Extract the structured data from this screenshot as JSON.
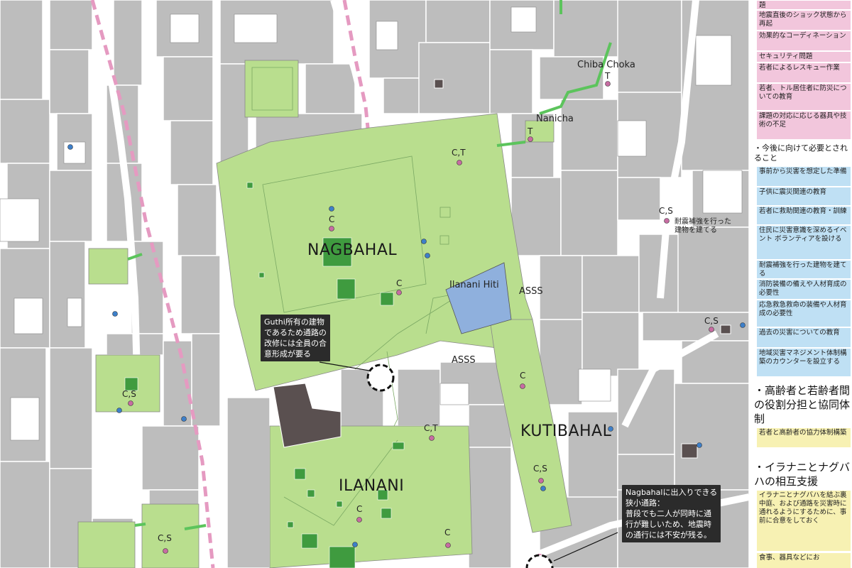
{
  "map": {
    "areas": [
      "NAGBAHAL",
      "ILANANI",
      "KUTIBAHAL"
    ],
    "places": [
      "Chiba Choka",
      "Nanicha",
      "Ilanani Hiti"
    ],
    "asss": [
      "ASSS",
      "ASSS"
    ],
    "codes": [
      "T",
      "T",
      "C,T",
      "C",
      "C",
      "C,S",
      "C,S",
      "C",
      "C,T",
      "C,S",
      "C",
      "C",
      "C,S"
    ],
    "annotations": {
      "retrofit": "耐震補強を行った\n建物を建てる",
      "guthi": "Guthi所有の建物\nであるため通路の\n改修には全員の合\n意形成が要る",
      "alley": "Nagbahalに出入りできる\n狭小通路：\n普段でも二人が同時に通\n行が難しいため、地震時\nの通行には不安が残る。"
    },
    "colors": {
      "building": "#bdbdbd",
      "open_space": "#b9de8e",
      "dark_block": "#5a5050",
      "water": "#8fb0dd",
      "pink_route": "#e59ac1",
      "green_path": "#5cc45c",
      "marker_pink": "#c76ca2",
      "marker_blue": "#3d7fc9"
    }
  },
  "legend": {
    "items_top": [
      "題",
      "地震直後のショック状態から再起",
      "効果的なコーディネーション",
      "セキュリティ問題",
      "若者によるレスキュー作業",
      "若者、トル居住者に防災についての教育",
      "課題の対応に応じる器具や技術の不足"
    ],
    "heading_needs": "・今後に向けて必要とされること",
    "items_needs": [
      "事前から災害を想定した準備",
      "子供に震災関連の教育",
      "若者に救助関連の教育・訓練",
      "住民に災害意識を深めるイベント ボランティアを設ける",
      "耐震補強を行った建物を建てる",
      "消防装備の備えや人材育成の必要性",
      "応急救急救命の装備や人材育成の必要性",
      "過去の災害についての教育",
      "地域災害マネジメント体制構築のカウンターを設立する"
    ],
    "heading_roles": "・高齢者と若齢者間の役割分担と協同体制",
    "items_roles": [
      "若者と高齢者の協力体制構築"
    ],
    "heading_mutual": "・イラナニとナグバハの相互支援",
    "items_mutual": [
      "イラナニとナグバハを結ぶ裏中庭、および通路を災害時に通れるようにするために、事前に合意をしておく",
      "食事、器具などにお"
    ]
  }
}
